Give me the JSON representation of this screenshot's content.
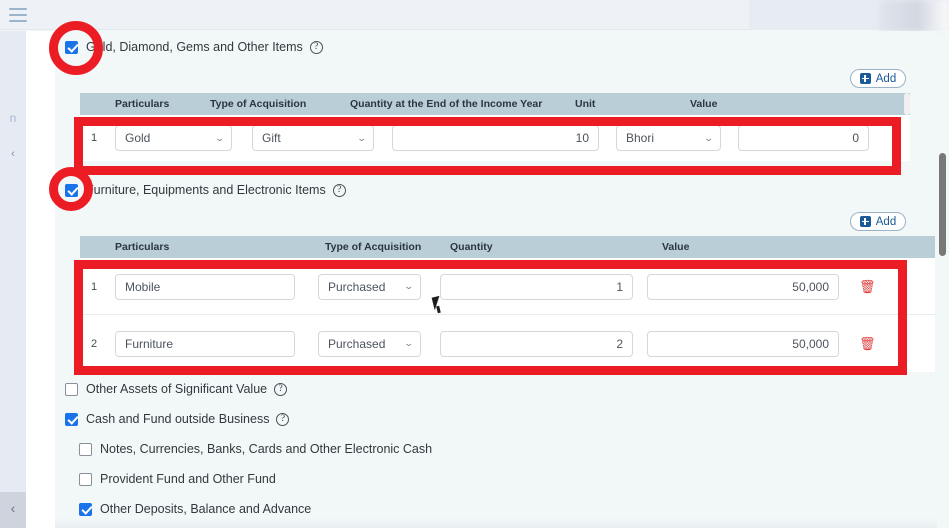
{
  "window": {
    "menu_icon": "hamburger-icon",
    "left_rail_text": "n",
    "left_rail_chevron": "‹",
    "left_rail_bottom_chevron": "‹"
  },
  "sections": [
    {
      "id": "gold",
      "checkbox_checked": true,
      "label": "Gold, Diamond, Gems and Other Items",
      "help_icon": "help-circle-icon",
      "add_button": {
        "label": "Add",
        "icon": "plus-square-icon"
      },
      "columns": [
        "Particulars",
        "Type of Acquisition",
        "Quantity at the End of the Income Year",
        "Unit",
        "Value"
      ],
      "rows": [
        {
          "no": "1",
          "particulars": "Gold",
          "type_of_acquisition": "Gift",
          "quantity": "10",
          "unit": "Bhori",
          "value": "0"
        }
      ]
    },
    {
      "id": "furniture",
      "checkbox_checked": true,
      "label": "Furniture, Equipments and Electronic Items",
      "help_icon": "help-circle-icon",
      "add_button": {
        "label": "Add",
        "icon": "plus-square-icon"
      },
      "columns": [
        "Particulars",
        "Type of Acquisition",
        "Quantity",
        "Value"
      ],
      "rows": [
        {
          "no": "1",
          "particulars": "Mobile",
          "type_of_acquisition": "Purchased",
          "quantity": "1",
          "value": "50,000",
          "delete_icon": "trash-icon"
        },
        {
          "no": "2",
          "particulars": "Furniture",
          "type_of_acquisition": "Purchased",
          "quantity": "2",
          "value": "50,000",
          "delete_icon": "trash-icon"
        }
      ]
    }
  ],
  "checklist": [
    {
      "id": "other-assets",
      "checked": false,
      "label": "Other Assets of Significant Value",
      "help": true,
      "indent": 0
    },
    {
      "id": "cash-fund",
      "checked": true,
      "label": "Cash and Fund outside Business",
      "help": true,
      "indent": 0
    },
    {
      "id": "notes-currencies",
      "checked": false,
      "label": "Notes, Currencies, Banks, Cards and Other Electronic Cash",
      "help": false,
      "indent": 1
    },
    {
      "id": "provident-fund",
      "checked": false,
      "label": "Provident Fund and Other Fund",
      "help": false,
      "indent": 1
    },
    {
      "id": "other-deposits",
      "checked": true,
      "label": "Other Deposits, Balance and Advance",
      "help": false,
      "indent": 1
    }
  ],
  "colors": {
    "accent_blue": "#1a73e8",
    "table_header": "#b9ced6",
    "annotation_red": "#ec1c24",
    "delete_red": "#e23b3b",
    "page_bg": "#f2f7f7",
    "add_button_border": "#9ab2c6",
    "add_button_text": "#1a5a96"
  }
}
